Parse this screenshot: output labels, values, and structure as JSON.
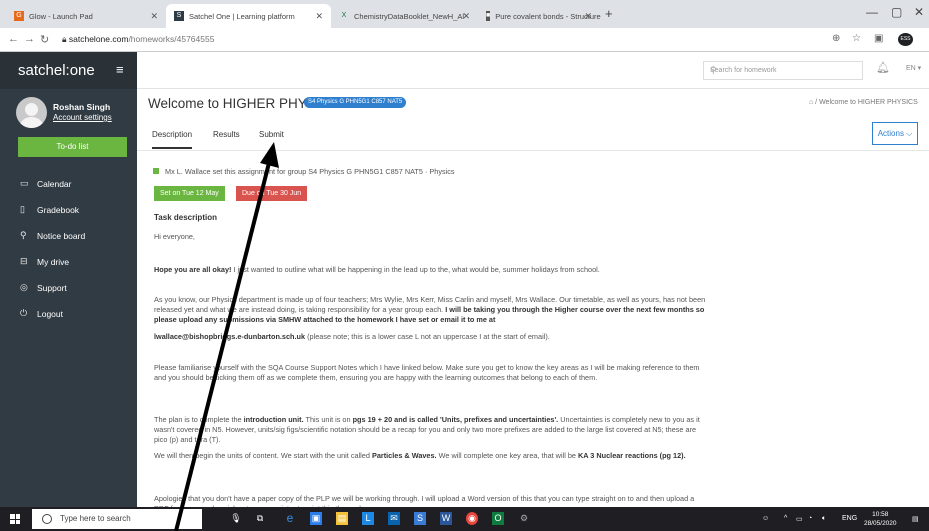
{
  "browser": {
    "tabs": [
      {
        "favicon": "glow-icon",
        "title": "Glow - Launch Pad",
        "active": false
      },
      {
        "favicon": "satchel-icon",
        "title": "Satchel One | Learning platform",
        "active": true
      },
      {
        "favicon": "excel-icon",
        "title": "ChemistryDataBooklet_NewH_Al",
        "active": false
      },
      {
        "favicon": "web-icon",
        "title": "Pure covalent bonds - Structure",
        "active": false
      }
    ],
    "new_tab": "+",
    "url_domain": "satchelone.com",
    "url_path": "/homeworks/45764555",
    "profile_ext": "ESS"
  },
  "sidebar": {
    "logo": "satchel:one",
    "user_name": "Roshan Singh",
    "account_settings": "Account settings",
    "todo_button": "To-do list",
    "items": [
      {
        "icon": "calendar-icon",
        "label": "Calendar"
      },
      {
        "icon": "gradebook-icon",
        "label": "Gradebook"
      },
      {
        "icon": "pin-icon",
        "label": "Notice board"
      },
      {
        "icon": "drive-icon",
        "label": "My drive"
      },
      {
        "icon": "support-icon",
        "label": "Support"
      },
      {
        "icon": "power-icon",
        "label": "Logout"
      }
    ]
  },
  "header": {
    "search_placeholder": "Search for homework",
    "lang": "EN ▾"
  },
  "main": {
    "title": "Welcome to HIGHER PHYSICS",
    "group_badge": "S4 Physics G PHN5G1 C857 NAT5",
    "breadcrumb": "Welcome to HIGHER PHYSICS",
    "tabs": [
      "Description",
      "Results",
      "Submit"
    ],
    "actions_button": "Actions",
    "set_by": "Mx L. Wallace set this assignment for group S4 Physics G PHN5G1 C857 NAT5 · Physics",
    "set_on": "Set on Tue 12 May",
    "due_on": "Due on Tue 30 Jun",
    "task_heading": "Task description",
    "greeting": "Hi everyone,",
    "p1_bold": "Hope you are all okay!",
    "p1_rest": " I just wanted to outline what will be happening in the lead up to the, what would be, summer holidays from school.",
    "p2_a": "As you know, our Physics department is made up of four teachers; Mrs Wylie, Mrs Kerr, Miss Carlin and myself, Mrs Wallace. Our timetable, as well as yours, has not been released yet and what we are instead doing, is taking responsibility for a year group each. ",
    "p2_b": "I will be taking you through the Higher course over the next few months so please upload any submissions via SMHW attached to the homework I have set or email it to me at",
    "email": "lwallace@bishopbriggs.e-dunbarton.sch.uk",
    "email_note": " (please note; this is a lower case L not an uppercase I at the start of email).",
    "p3": "Please familiarise yourself with the SQA Course Support Notes which I have linked below. Make sure you get to know the key areas as I will be making reference to them and you should be ticking them off as we complete them, ensuring you are happy with the learning outcomes that belong to each of them.",
    "p4_a": "The plan is to complete the ",
    "p4_b": "introduction unit.",
    "p4_c": " This unit is on ",
    "p4_d": "pgs 19 + 20 and is called 'Units, prefixes and uncertainties'.",
    "p4_e": " Uncertainties is completely new to you as it wasn't covered in N5. However, units/sig figs/scientific notation should be a recap for you and only two more prefixes are added to the large list covered at N5; these are pico (p) and tera (T).",
    "p5_a": "We will then begin the units of content. We start with the unit called ",
    "p5_b": "Particles & Waves.",
    "p5_c": " We will complete one key area, that will be ",
    "p5_d": "KA 3 Nuclear reactions (pg 12).",
    "p6": "Apologies that you don't have a paper copy of the PLP we will be working through. I will upload a Word version of this that you can type straight on to and then upload a PDF for anyone who wishes to use a printer to print this themselves."
  },
  "taskbar": {
    "search_placeholder": "Type here to search",
    "lang": "ENG",
    "time": "10:58",
    "date": "28/05/2020"
  },
  "colors": {
    "sidebar": "#313b43",
    "accent_green": "#6ab640",
    "due_red": "#d9534f",
    "link_blue": "#2f7fcf"
  }
}
